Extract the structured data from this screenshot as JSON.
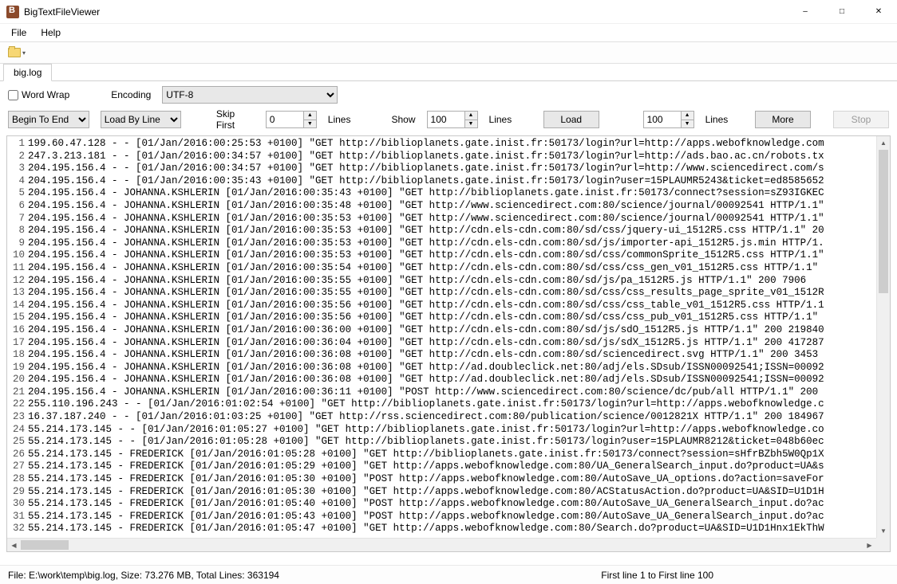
{
  "window": {
    "title": "BigTextFileViewer"
  },
  "menu": {
    "file": "File",
    "help": "Help"
  },
  "tabs": {
    "active": "big.log"
  },
  "options": {
    "word_wrap_label": "Word Wrap",
    "word_wrap_checked": false,
    "encoding_label": "Encoding",
    "encoding_value": "UTF-8"
  },
  "load": {
    "direction": "Begin To End",
    "mode": "Load By Line",
    "skip_first_label": "Skip First",
    "skip_first_value": "0",
    "skip_first_unit": "Lines",
    "show_label": "Show",
    "show_value": "100",
    "show_unit": "Lines",
    "load_button": "Load",
    "more_value": "100",
    "more_unit": "Lines",
    "more_button": "More",
    "stop_button": "Stop"
  },
  "status": {
    "left": "File: E:\\work\\temp\\big.log, Size: 73.276 MB, Total Lines: 363194",
    "right": "First line 1 to First line 100"
  },
  "lines": [
    "199.60.47.128 - - [01/Jan/2016:00:25:53 +0100] \"GET http://biblioplanets.gate.inist.fr:50173/login?url=http://apps.webofknowledge.com",
    "247.3.213.181 - - [01/Jan/2016:00:34:57 +0100] \"GET http://biblioplanets.gate.inist.fr:50173/login?url=http://ads.bao.ac.cn/robots.tx",
    "204.195.156.4 - - [01/Jan/2016:00:34:57 +0100] \"GET http://biblioplanets.gate.inist.fr:50173/login?url=http://www.sciencedirect.com/s",
    "204.195.156.4 - - [01/Jan/2016:00:35:43 +0100] \"GET http://biblioplanets.gate.inist.fr:50173/login?user=15PLAUMR5243&ticket=ed8585652",
    "204.195.156.4 - JOHANNA.KSHLERIN [01/Jan/2016:00:35:43 +0100] \"GET http://biblioplanets.gate.inist.fr:50173/connect?session=sZ93IGKEC",
    "204.195.156.4 - JOHANNA.KSHLERIN [01/Jan/2016:00:35:48 +0100] \"GET http://www.sciencedirect.com:80/science/journal/00092541 HTTP/1.1\"",
    "204.195.156.4 - JOHANNA.KSHLERIN [01/Jan/2016:00:35:53 +0100] \"GET http://www.sciencedirect.com:80/science/journal/00092541 HTTP/1.1\"",
    "204.195.156.4 - JOHANNA.KSHLERIN [01/Jan/2016:00:35:53 +0100] \"GET http://cdn.els-cdn.com:80/sd/css/jquery-ui_1512R5.css HTTP/1.1\" 20",
    "204.195.156.4 - JOHANNA.KSHLERIN [01/Jan/2016:00:35:53 +0100] \"GET http://cdn.els-cdn.com:80/sd/js/importer-api_1512R5.js.min HTTP/1.",
    "204.195.156.4 - JOHANNA.KSHLERIN [01/Jan/2016:00:35:53 +0100] \"GET http://cdn.els-cdn.com:80/sd/css/commonSprite_1512R5.css HTTP/1.1\"",
    "204.195.156.4 - JOHANNA.KSHLERIN [01/Jan/2016:00:35:54 +0100] \"GET http://cdn.els-cdn.com:80/sd/css/css_gen_v01_1512R5.css HTTP/1.1\"",
    "204.195.156.4 - JOHANNA.KSHLERIN [01/Jan/2016:00:35:55 +0100] \"GET http://cdn.els-cdn.com:80/sd/js/pa_1512R5.js HTTP/1.1\" 200 7906",
    "204.195.156.4 - JOHANNA.KSHLERIN [01/Jan/2016:00:35:55 +0100] \"GET http://cdn.els-cdn.com:80/sd/css/css_results_page_sprite_v01_1512R",
    "204.195.156.4 - JOHANNA.KSHLERIN [01/Jan/2016:00:35:56 +0100] \"GET http://cdn.els-cdn.com:80/sd/css/css_table_v01_1512R5.css HTTP/1.1",
    "204.195.156.4 - JOHANNA.KSHLERIN [01/Jan/2016:00:35:56 +0100] \"GET http://cdn.els-cdn.com:80/sd/css/css_pub_v01_1512R5.css HTTP/1.1\"",
    "204.195.156.4 - JOHANNA.KSHLERIN [01/Jan/2016:00:36:00 +0100] \"GET http://cdn.els-cdn.com:80/sd/js/sdO_1512R5.js HTTP/1.1\" 200 219840",
    "204.195.156.4 - JOHANNA.KSHLERIN [01/Jan/2016:00:36:04 +0100] \"GET http://cdn.els-cdn.com:80/sd/js/sdX_1512R5.js HTTP/1.1\" 200 417287",
    "204.195.156.4 - JOHANNA.KSHLERIN [01/Jan/2016:00:36:08 +0100] \"GET http://cdn.els-cdn.com:80/sd/sciencedirect.svg HTTP/1.1\" 200 3453",
    "204.195.156.4 - JOHANNA.KSHLERIN [01/Jan/2016:00:36:08 +0100] \"GET http://ad.doubleclick.net:80/adj/els.SDsub/ISSN00092541;ISSN=00092",
    "204.195.156.4 - JOHANNA.KSHLERIN [01/Jan/2016:00:36:08 +0100] \"GET http://ad.doubleclick.net:80/adj/els.SDsub/ISSN00092541;ISSN=00092",
    "204.195.156.4 - JOHANNA.KSHLERIN [01/Jan/2016:00:36:11 +0100] \"POST http://www.sciencedirect.com:80/science/dc/pub/all HTTP/1.1\" 200",
    "255.110.196.243 - - [01/Jan/2016:01:02:54 +0100] \"GET http://biblioplanets.gate.inist.fr:50173/login?url=http://apps.webofknowledge.c",
    "16.37.187.240 - - [01/Jan/2016:01:03:25 +0100] \"GET http://rss.sciencedirect.com:80/publication/science/0012821X HTTP/1.1\" 200 184967",
    "55.214.173.145 - - [01/Jan/2016:01:05:27 +0100] \"GET http://biblioplanets.gate.inist.fr:50173/login?url=http://apps.webofknowledge.co",
    "55.214.173.145 - - [01/Jan/2016:01:05:28 +0100] \"GET http://biblioplanets.gate.inist.fr:50173/login?user=15PLAUMR8212&ticket=048b60ec",
    "55.214.173.145 - FREDERICK [01/Jan/2016:01:05:28 +0100] \"GET http://biblioplanets.gate.inist.fr:50173/connect?session=sHfrBZbh5W0Qp1X",
    "55.214.173.145 - FREDERICK [01/Jan/2016:01:05:29 +0100] \"GET http://apps.webofknowledge.com:80/UA_GeneralSearch_input.do?product=UA&s",
    "55.214.173.145 - FREDERICK [01/Jan/2016:01:05:30 +0100] \"POST http://apps.webofknowledge.com:80/AutoSave_UA_options.do?action=saveFor",
    "55.214.173.145 - FREDERICK [01/Jan/2016:01:05:30 +0100] \"GET http://apps.webofknowledge.com:80/ACStatusAction.do?product=UA&SID=U1D1H",
    "55.214.173.145 - FREDERICK [01/Jan/2016:01:05:40 +0100] \"POST http://apps.webofknowledge.com:80/AutoSave_UA_GeneralSearch_input.do?ac",
    "55.214.173.145 - FREDERICK [01/Jan/2016:01:05:43 +0100] \"POST http://apps.webofknowledge.com:80/AutoSave_UA_GeneralSearch_input.do?ac",
    "55.214.173.145 - FREDERICK [01/Jan/2016:01:05:47 +0100] \"GET http://apps.webofknowledge.com:80/Search.do?product=UA&SID=U1D1Hnx1EkThW"
  ]
}
